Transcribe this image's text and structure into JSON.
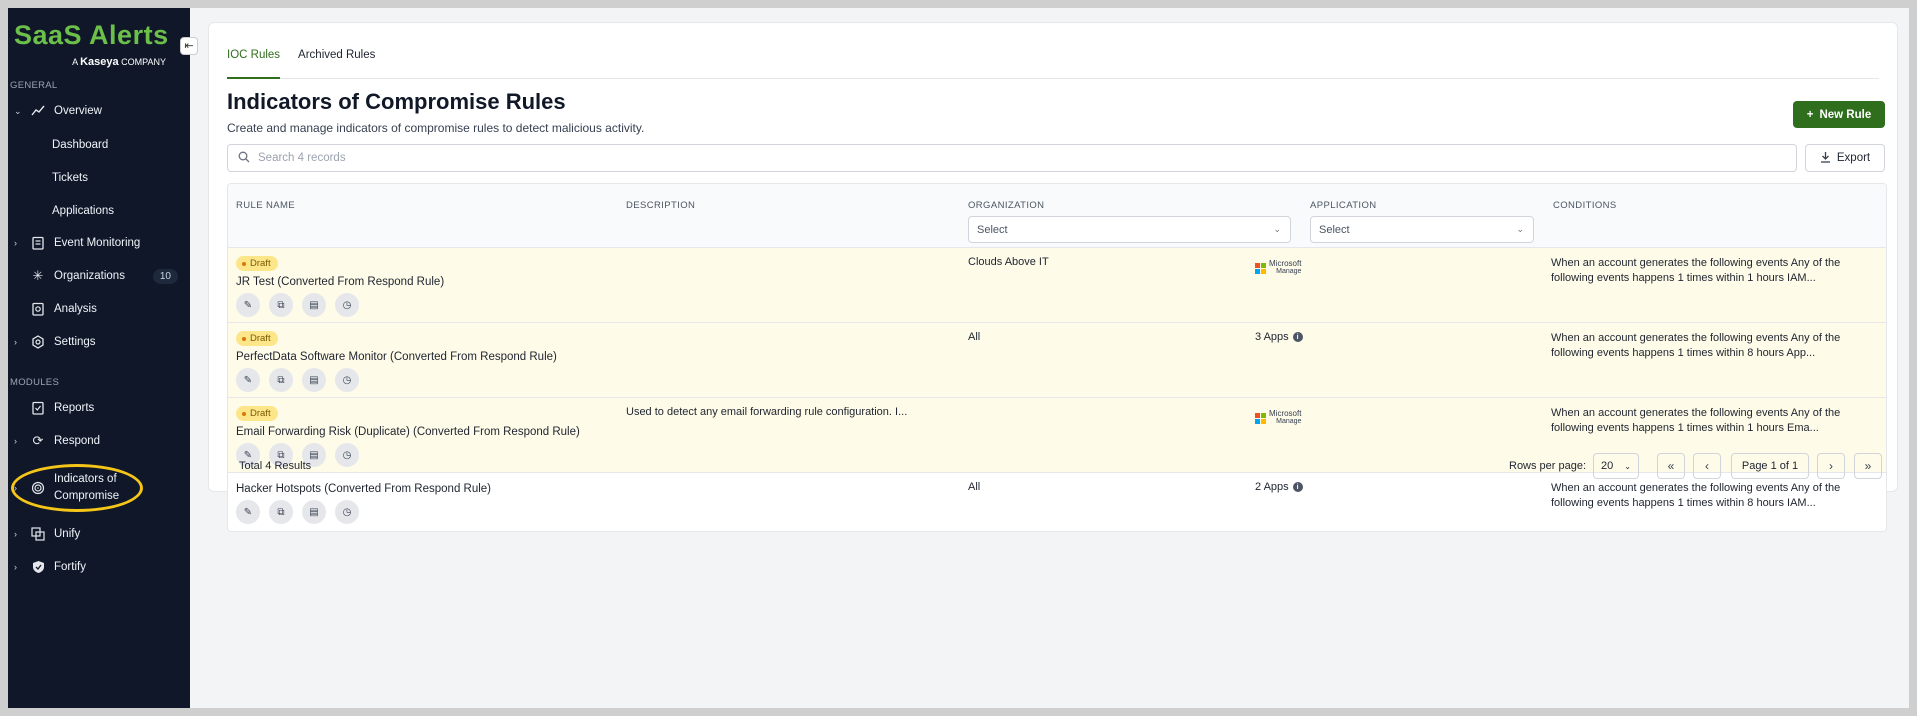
{
  "sidebar": {
    "logo_text": "SaaS Alerts",
    "logo_sub_prefix": "A",
    "logo_sub_brand": "Kaseya",
    "logo_sub_suffix": "COMPANY",
    "general_label": "GENERAL",
    "modules_label": "MODULES",
    "overview": "Overview",
    "dashboard": "Dashboard",
    "tickets": "Tickets",
    "applications": "Applications",
    "event_monitoring": "Event Monitoring",
    "organizations": "Organizations",
    "organizations_count": "10",
    "analysis": "Analysis",
    "settings": "Settings",
    "reports": "Reports",
    "respond": "Respond",
    "ioc_line1": "Indicators of",
    "ioc_line2": "Compromise",
    "unify": "Unify",
    "fortify": "Fortify"
  },
  "tabs": [
    {
      "label": "IOC Rules"
    },
    {
      "label": "Archived Rules"
    }
  ],
  "header": {
    "title": "Indicators of Compromise Rules",
    "description": "Create and manage indicators of compromise rules to detect malicious activity.",
    "new_rule_label": "New Rule",
    "export_label": "Export",
    "search_placeholder": "Search 4 records"
  },
  "table": {
    "columns": {
      "rule_name": "RULE NAME",
      "description": "DESCRIPTION",
      "organization": "ORGANIZATION",
      "application": "APPLICATION",
      "conditions": "CONDITIONS"
    },
    "org_filter": "Select",
    "app_filter": "Select",
    "draft_label": "Draft",
    "ms_line1": "Microsoft",
    "ms_line2": "Manage",
    "rows": [
      {
        "name": "JR Test (Converted From Respond Rule)",
        "description": "",
        "organization": "Clouds Above IT",
        "application": "",
        "conditions": "When an account generates the following events Any of the following events happens 1 times within 1 hours IAM..."
      },
      {
        "name": "PerfectData Software Monitor (Converted From Respond Rule)",
        "description": "",
        "organization": "All",
        "application": "3 Apps",
        "conditions": "When an account generates the following events Any of the following events happens 1 times within 8 hours App..."
      },
      {
        "name": "Email Forwarding Risk (Duplicate) (Converted From Respond Rule)",
        "description": "Used to detect any email forwarding rule configuration. I...",
        "organization": "",
        "application": "",
        "conditions": "When an account generates the following events Any of the following events happens 1 times within 1 hours Ema..."
      },
      {
        "name": "Hacker Hotspots (Converted From Respond Rule)",
        "description": "",
        "organization": "All",
        "application": "2 Apps",
        "conditions": "When an account generates the following events Any of the following events happens 1 times within 8 hours IAM..."
      }
    ]
  },
  "footer": {
    "total": "Total 4 Results",
    "rows_per_page_label": "Rows per page:",
    "rows_per_page": "20",
    "page_info": "Page 1 of 1"
  },
  "colors": {
    "accent": "#2f6e1d",
    "sidebar_bg": "#0f1729",
    "draft_row_bg": "#fefbe8",
    "highlight": "#f5c518"
  }
}
